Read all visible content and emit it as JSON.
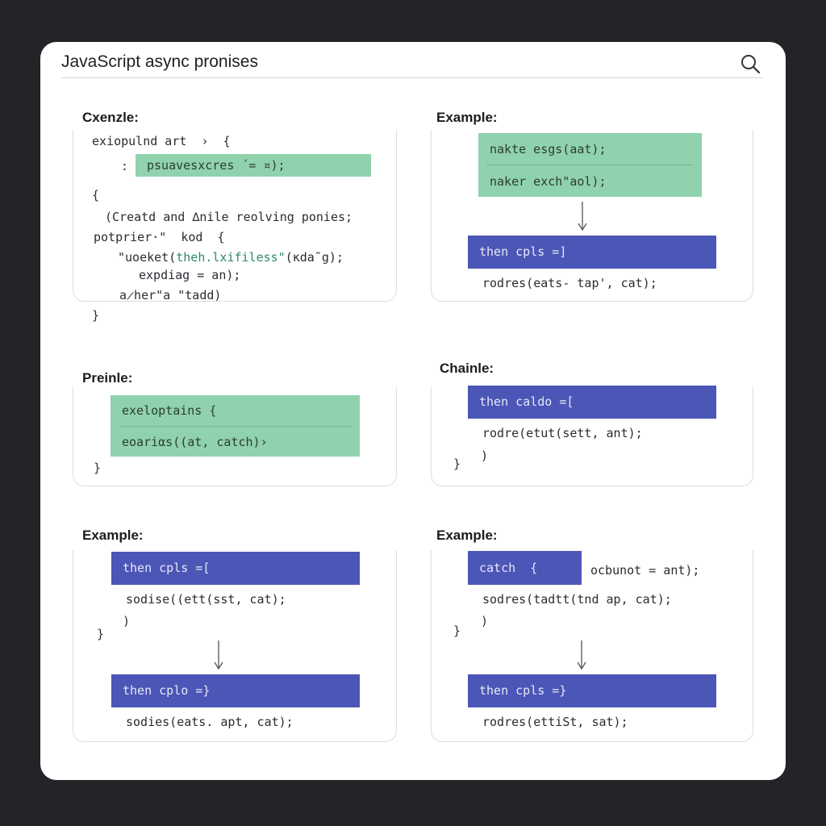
{
  "window": {
    "title": "JavaScript async pronises",
    "search_icon": "search-icon"
  },
  "panels": [
    {
      "label": "Cxenzle:",
      "lines": [
        "exiopulnd art  ›  {",
        "psuavesxcres ´= ¤);",
        "{",
        "(Creatd and ∆nile reolving ponies;",
        "potprier·\"  kod  {",
        "\"uoeket(",
        "theh.lxifiless\"",
        "(κda˜g);",
        "expdiag = an);",
        "a̷her\"a \"tadd)",
        "}"
      ],
      "colon": ":"
    },
    {
      "label": "Example:",
      "green_rows": [
        "nakte esgs(aat);",
        "naker exch\"aol);"
      ],
      "blue": "then cpls =]",
      "after": "rodres(eats- tap', cat);"
    },
    {
      "label": "Preinle:",
      "green_rows": [
        "exeloptains {",
        "eoariαs((at, catch)›"
      ],
      "close": "}"
    },
    {
      "label": "Chainle:",
      "blue": "then caldo =[",
      "lines": [
        "rodre(etut(sett, ant);",
        ")"
      ],
      "close": "}"
    },
    {
      "label": "Example:",
      "blue_top": "then cpls =[",
      "lines": [
        "sodise((ett(sst, cat);",
        ")"
      ],
      "close": "}",
      "blue_bottom": "then cplo =}",
      "after": "sodies(eats. apt, cat);"
    },
    {
      "label": "Example:",
      "blue_top": "catch  {",
      "blue_top_tail": "ocbunot = ant);",
      "lines": [
        "sodres(tadtt(tnd ap, cat);",
        ")"
      ],
      "close": "}",
      "blue_bottom": "then cpls =}",
      "after": "rodres(ettiSt, sat);"
    }
  ],
  "colors": {
    "background": "#242428",
    "panel": "#ffffff",
    "green_block": "#8fd2ad",
    "blue_block": "#4c56b6"
  }
}
